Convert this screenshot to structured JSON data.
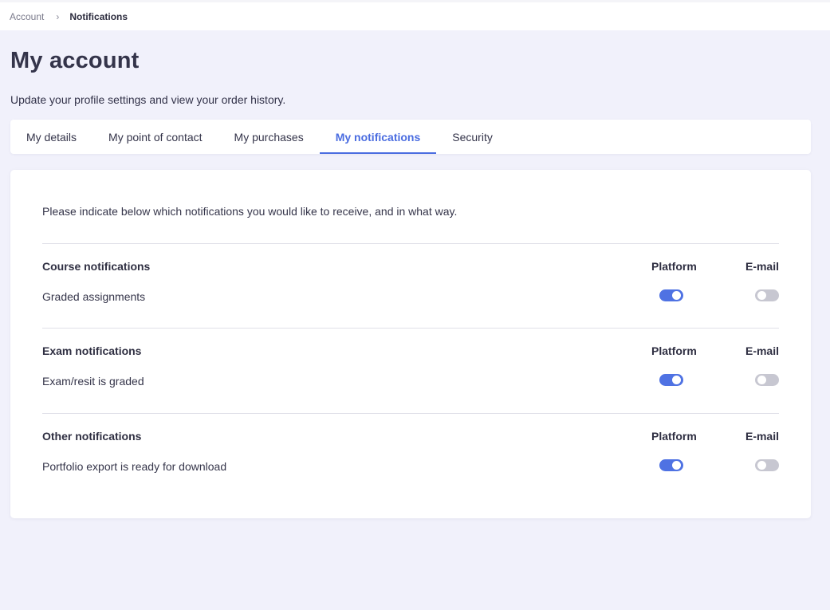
{
  "breadcrumb": {
    "root": "Account",
    "separator": "›",
    "current": "Notifications"
  },
  "page": {
    "title": "My account",
    "subtitle": "Update your profile settings and view your order history."
  },
  "tabs": [
    {
      "label": "My details",
      "active": false
    },
    {
      "label": "My point of contact",
      "active": false
    },
    {
      "label": "My purchases",
      "active": false
    },
    {
      "label": "My notifications",
      "active": true
    },
    {
      "label": "Security",
      "active": false
    }
  ],
  "notifications": {
    "intro": "Please indicate below which notifications you would like to receive, and in what way.",
    "column_platform": "Platform",
    "column_email": "E-mail",
    "sections": [
      {
        "title": "Course notifications",
        "item": "Graded assignments",
        "platform_on": true,
        "email_on": false
      },
      {
        "title": "Exam notifications",
        "item": "Exam/resit is graded",
        "platform_on": true,
        "email_on": false
      },
      {
        "title": "Other notifications",
        "item": "Portfolio export is ready for download",
        "platform_on": true,
        "email_on": false
      }
    ]
  },
  "colors": {
    "accent": "#4a6ce0",
    "toggle_on": "#4f72e3",
    "toggle_off": "#c7c7d1",
    "background": "#f1f1fb"
  }
}
